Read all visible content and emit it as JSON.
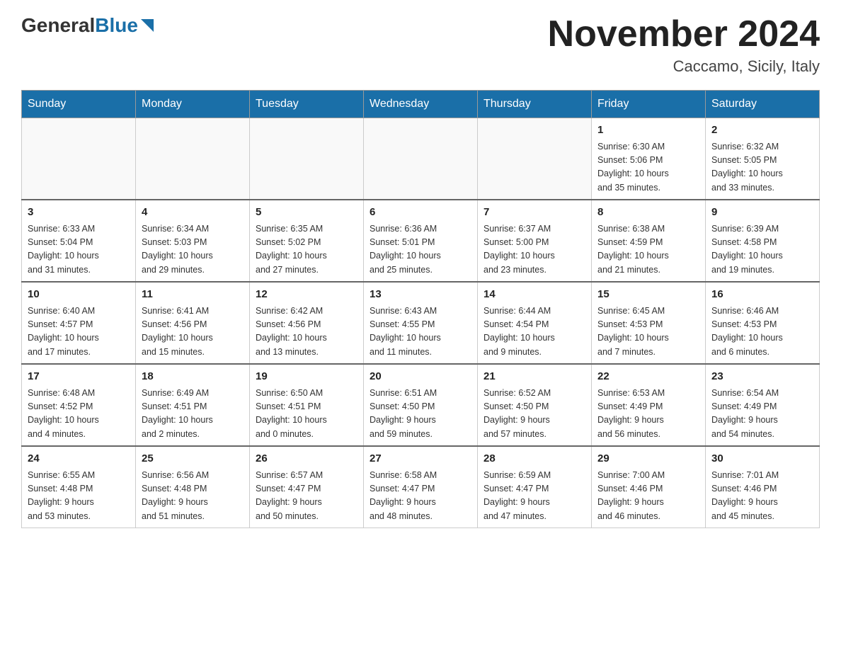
{
  "header": {
    "logo_general": "General",
    "logo_blue": "Blue",
    "month_title": "November 2024",
    "location": "Caccamo, Sicily, Italy"
  },
  "weekdays": [
    "Sunday",
    "Monday",
    "Tuesday",
    "Wednesday",
    "Thursday",
    "Friday",
    "Saturday"
  ],
  "weeks": [
    [
      {
        "day": "",
        "info": ""
      },
      {
        "day": "",
        "info": ""
      },
      {
        "day": "",
        "info": ""
      },
      {
        "day": "",
        "info": ""
      },
      {
        "day": "",
        "info": ""
      },
      {
        "day": "1",
        "info": "Sunrise: 6:30 AM\nSunset: 5:06 PM\nDaylight: 10 hours\nand 35 minutes."
      },
      {
        "day": "2",
        "info": "Sunrise: 6:32 AM\nSunset: 5:05 PM\nDaylight: 10 hours\nand 33 minutes."
      }
    ],
    [
      {
        "day": "3",
        "info": "Sunrise: 6:33 AM\nSunset: 5:04 PM\nDaylight: 10 hours\nand 31 minutes."
      },
      {
        "day": "4",
        "info": "Sunrise: 6:34 AM\nSunset: 5:03 PM\nDaylight: 10 hours\nand 29 minutes."
      },
      {
        "day": "5",
        "info": "Sunrise: 6:35 AM\nSunset: 5:02 PM\nDaylight: 10 hours\nand 27 minutes."
      },
      {
        "day": "6",
        "info": "Sunrise: 6:36 AM\nSunset: 5:01 PM\nDaylight: 10 hours\nand 25 minutes."
      },
      {
        "day": "7",
        "info": "Sunrise: 6:37 AM\nSunset: 5:00 PM\nDaylight: 10 hours\nand 23 minutes."
      },
      {
        "day": "8",
        "info": "Sunrise: 6:38 AM\nSunset: 4:59 PM\nDaylight: 10 hours\nand 21 minutes."
      },
      {
        "day": "9",
        "info": "Sunrise: 6:39 AM\nSunset: 4:58 PM\nDaylight: 10 hours\nand 19 minutes."
      }
    ],
    [
      {
        "day": "10",
        "info": "Sunrise: 6:40 AM\nSunset: 4:57 PM\nDaylight: 10 hours\nand 17 minutes."
      },
      {
        "day": "11",
        "info": "Sunrise: 6:41 AM\nSunset: 4:56 PM\nDaylight: 10 hours\nand 15 minutes."
      },
      {
        "day": "12",
        "info": "Sunrise: 6:42 AM\nSunset: 4:56 PM\nDaylight: 10 hours\nand 13 minutes."
      },
      {
        "day": "13",
        "info": "Sunrise: 6:43 AM\nSunset: 4:55 PM\nDaylight: 10 hours\nand 11 minutes."
      },
      {
        "day": "14",
        "info": "Sunrise: 6:44 AM\nSunset: 4:54 PM\nDaylight: 10 hours\nand 9 minutes."
      },
      {
        "day": "15",
        "info": "Sunrise: 6:45 AM\nSunset: 4:53 PM\nDaylight: 10 hours\nand 7 minutes."
      },
      {
        "day": "16",
        "info": "Sunrise: 6:46 AM\nSunset: 4:53 PM\nDaylight: 10 hours\nand 6 minutes."
      }
    ],
    [
      {
        "day": "17",
        "info": "Sunrise: 6:48 AM\nSunset: 4:52 PM\nDaylight: 10 hours\nand 4 minutes."
      },
      {
        "day": "18",
        "info": "Sunrise: 6:49 AM\nSunset: 4:51 PM\nDaylight: 10 hours\nand 2 minutes."
      },
      {
        "day": "19",
        "info": "Sunrise: 6:50 AM\nSunset: 4:51 PM\nDaylight: 10 hours\nand 0 minutes."
      },
      {
        "day": "20",
        "info": "Sunrise: 6:51 AM\nSunset: 4:50 PM\nDaylight: 9 hours\nand 59 minutes."
      },
      {
        "day": "21",
        "info": "Sunrise: 6:52 AM\nSunset: 4:50 PM\nDaylight: 9 hours\nand 57 minutes."
      },
      {
        "day": "22",
        "info": "Sunrise: 6:53 AM\nSunset: 4:49 PM\nDaylight: 9 hours\nand 56 minutes."
      },
      {
        "day": "23",
        "info": "Sunrise: 6:54 AM\nSunset: 4:49 PM\nDaylight: 9 hours\nand 54 minutes."
      }
    ],
    [
      {
        "day": "24",
        "info": "Sunrise: 6:55 AM\nSunset: 4:48 PM\nDaylight: 9 hours\nand 53 minutes."
      },
      {
        "day": "25",
        "info": "Sunrise: 6:56 AM\nSunset: 4:48 PM\nDaylight: 9 hours\nand 51 minutes."
      },
      {
        "day": "26",
        "info": "Sunrise: 6:57 AM\nSunset: 4:47 PM\nDaylight: 9 hours\nand 50 minutes."
      },
      {
        "day": "27",
        "info": "Sunrise: 6:58 AM\nSunset: 4:47 PM\nDaylight: 9 hours\nand 48 minutes."
      },
      {
        "day": "28",
        "info": "Sunrise: 6:59 AM\nSunset: 4:47 PM\nDaylight: 9 hours\nand 47 minutes."
      },
      {
        "day": "29",
        "info": "Sunrise: 7:00 AM\nSunset: 4:46 PM\nDaylight: 9 hours\nand 46 minutes."
      },
      {
        "day": "30",
        "info": "Sunrise: 7:01 AM\nSunset: 4:46 PM\nDaylight: 9 hours\nand 45 minutes."
      }
    ]
  ]
}
